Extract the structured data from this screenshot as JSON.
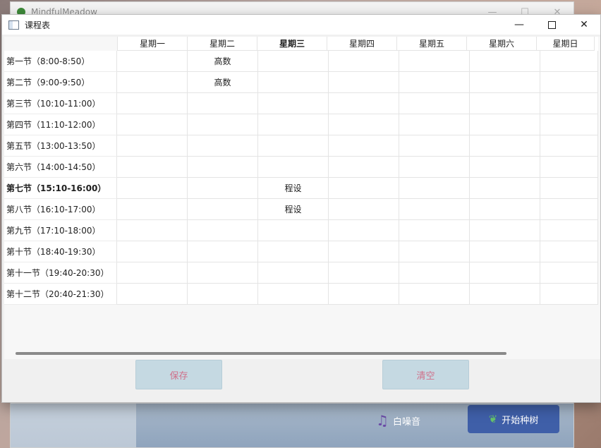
{
  "background_app": {
    "title": "MindfulMeadow",
    "white_noise_label": "白噪音",
    "plant_button_label": "开始种树"
  },
  "dialog": {
    "title": "课程表",
    "controls": {
      "minimize": "—",
      "close": "✕"
    }
  },
  "schedule": {
    "days": [
      "星期一",
      "星期二",
      "星期三",
      "星期四",
      "星期五",
      "星期六",
      "星期日"
    ],
    "bold_day_index": 2,
    "periods": [
      {
        "label": "第一节（8:00-8:50）",
        "cells": [
          "",
          "高数",
          "",
          "",
          "",
          "",
          ""
        ]
      },
      {
        "label": "第二节（9:00-9:50）",
        "cells": [
          "",
          "高数",
          "",
          "",
          "",
          "",
          ""
        ]
      },
      {
        "label": "第三节（10:10-11:00）",
        "cells": [
          "",
          "",
          "",
          "",
          "",
          "",
          ""
        ]
      },
      {
        "label": "第四节（11:10-12:00）",
        "cells": [
          "",
          "",
          "",
          "",
          "",
          "",
          ""
        ]
      },
      {
        "label": "第五节（13:00-13:50）",
        "cells": [
          "",
          "",
          "",
          "",
          "",
          "",
          ""
        ]
      },
      {
        "label": "第六节（14:00-14:50）",
        "cells": [
          "",
          "",
          "",
          "",
          "",
          "",
          ""
        ]
      },
      {
        "label": "第七节（15:10-16:00）",
        "cells": [
          "",
          "",
          "程设",
          "",
          "",
          "",
          ""
        ]
      },
      {
        "label": "第八节（16:10-17:00）",
        "cells": [
          "",
          "",
          "程设",
          "",
          "",
          "",
          ""
        ]
      },
      {
        "label": "第九节（17:10-18:00）",
        "cells": [
          "",
          "",
          "",
          "",
          "",
          "",
          ""
        ]
      },
      {
        "label": "第十节（18:40-19:30）",
        "cells": [
          "",
          "",
          "",
          "",
          "",
          "",
          ""
        ]
      },
      {
        "label": "第十一节（19:40-20:30）",
        "cells": [
          "",
          "",
          "",
          "",
          "",
          "",
          ""
        ]
      },
      {
        "label": "第十二节（20:40-21:30）",
        "cells": [
          "",
          "",
          "",
          "",
          "",
          "",
          ""
        ]
      }
    ],
    "bold_period_index": 6
  },
  "actions": {
    "save_label": "保存",
    "clear_label": "清空"
  },
  "colors": {
    "button_bg": "#c5d9e2",
    "button_text": "#d0708a",
    "plant_button_bg": "#3f5fa8"
  }
}
